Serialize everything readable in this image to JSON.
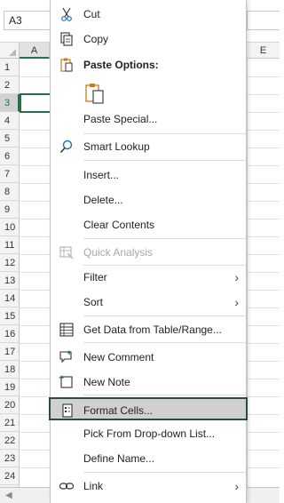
{
  "formula_bar": {
    "name_box": "A3"
  },
  "columns": {
    "a": "A",
    "e": "E"
  },
  "rows": [
    "1",
    "2",
    "3",
    "4",
    "5",
    "6",
    "7",
    "8",
    "9",
    "10",
    "11",
    "12",
    "13",
    "14",
    "15",
    "16",
    "17",
    "18",
    "19",
    "20",
    "21",
    "22",
    "23",
    "24"
  ],
  "context_menu": {
    "cut": "Cut",
    "copy": "Copy",
    "paste_options": "Paste Options:",
    "paste_special": "Paste Special...",
    "smart_lookup": "Smart Lookup",
    "insert": "Insert...",
    "delete": "Delete...",
    "clear_contents": "Clear Contents",
    "quick_analysis": "Quick Analysis",
    "filter": "Filter",
    "sort": "Sort",
    "get_data": "Get Data from Table/Range...",
    "new_comment": "New Comment",
    "new_note": "New Note",
    "format_cells": "Format Cells...",
    "pick_dropdown": "Pick From Drop-down List...",
    "define_name": "Define Name...",
    "link": "Link"
  },
  "colors": {
    "excel_green": "#217346",
    "hover_border": "#2b4a4a",
    "hover_bg": "#d0d0d0"
  }
}
